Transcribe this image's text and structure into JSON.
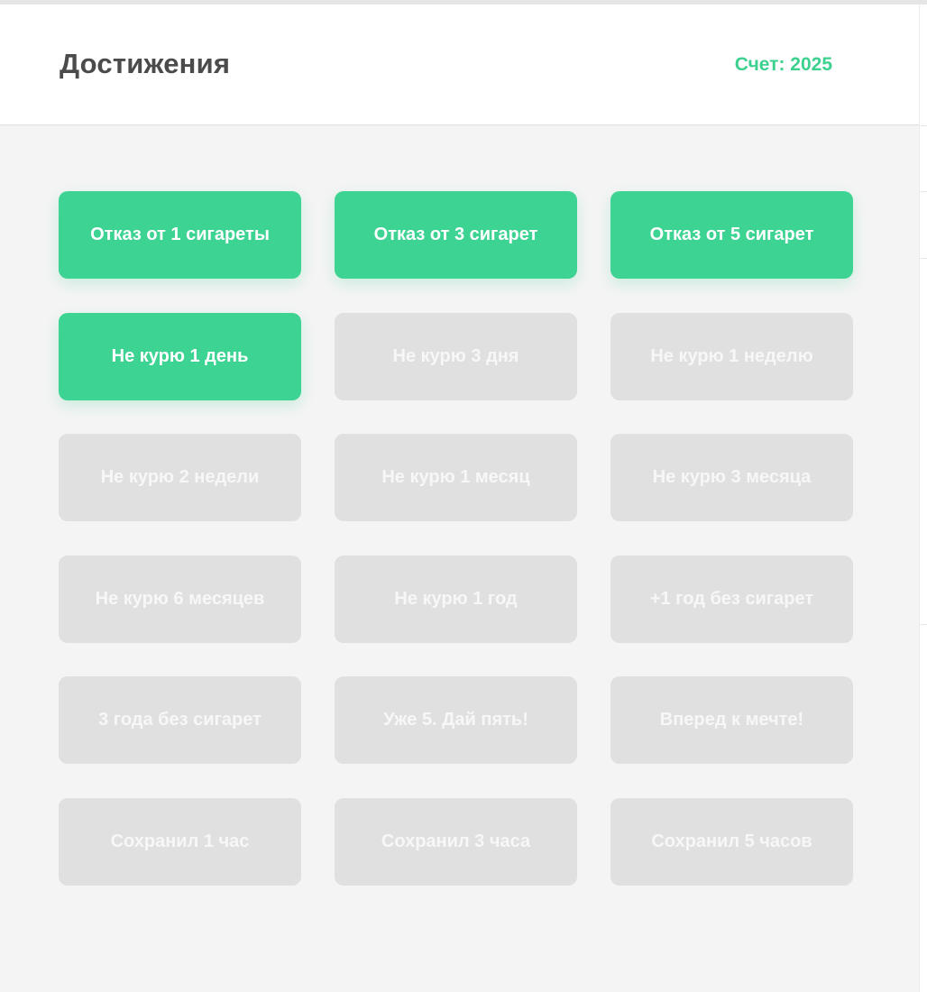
{
  "header": {
    "title": "Достижения",
    "score": "Счет: 2025"
  },
  "colors": {
    "accent": "#3dd393",
    "locked": "#e0e0e0",
    "background": "#f4f4f4"
  },
  "achievements": [
    {
      "label": "Отказ от 1 сигареты",
      "earned": true
    },
    {
      "label": "Отказ от 3 сигарет",
      "earned": true
    },
    {
      "label": "Отказ от 5 сигарет",
      "earned": true
    },
    {
      "label": "Не курю 1 день",
      "earned": true
    },
    {
      "label": "Не курю 3 дня",
      "earned": false
    },
    {
      "label": "Не курю 1 неделю",
      "earned": false
    },
    {
      "label": "Не курю 2 недели",
      "earned": false
    },
    {
      "label": "Не курю 1 месяц",
      "earned": false
    },
    {
      "label": "Не курю 3 месяца",
      "earned": false
    },
    {
      "label": "Не курю 6 месяцев",
      "earned": false
    },
    {
      "label": "Не курю 1 год",
      "earned": false
    },
    {
      "label": "+1 год без сигарет",
      "earned": false
    },
    {
      "label": "3 года без сигарет",
      "earned": false
    },
    {
      "label": "Уже 5. Дай пять!",
      "earned": false
    },
    {
      "label": "Вперед к мечте!",
      "earned": false
    },
    {
      "label": "Сохранил 1 час",
      "earned": false
    },
    {
      "label": "Сохранил 3 часа",
      "earned": false
    },
    {
      "label": "Сохранил 5 часов",
      "earned": false
    }
  ]
}
